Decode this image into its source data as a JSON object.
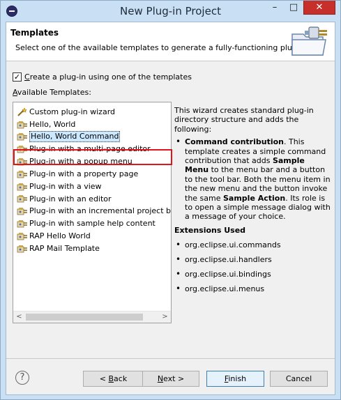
{
  "window": {
    "title": "New Plug-in Project",
    "controls": {
      "minimize": "–",
      "maximize": "□",
      "close": "✕"
    }
  },
  "header": {
    "title": "Templates",
    "description": "Select one of the available templates to generate a fully-functioning plug-in."
  },
  "checkbox": {
    "checked": true,
    "mnemonic": "C",
    "rest": "reate a plug-in using one of the templates"
  },
  "available_label": {
    "mnemonic": "A",
    "rest": "vailable Templates:"
  },
  "templates": [
    {
      "label": "Custom plug-in wizard",
      "icon": "wizard-icon"
    },
    {
      "label": "Hello, World",
      "icon": "plugin-template-icon"
    },
    {
      "label": "Hello, World Command",
      "icon": "plugin-template-icon",
      "selected": true
    },
    {
      "label": "Plug-in with a multi-page editor",
      "icon": "plugin-template-icon"
    },
    {
      "label": "Plug-in with a popup menu",
      "icon": "plugin-template-icon"
    },
    {
      "label": "Plug-in with a property page",
      "icon": "plugin-template-icon"
    },
    {
      "label": "Plug-in with a view",
      "icon": "plugin-template-icon"
    },
    {
      "label": "Plug-in with an editor",
      "icon": "plugin-template-icon"
    },
    {
      "label": "Plug-in with an incremental project build",
      "icon": "plugin-template-icon"
    },
    {
      "label": "Plug-in with sample help content",
      "icon": "plugin-template-icon"
    },
    {
      "label": "RAP Hello World",
      "icon": "plugin-template-icon"
    },
    {
      "label": "RAP Mail Template",
      "icon": "plugin-template-icon"
    }
  ],
  "description": {
    "intro": "This wizard creates standard plug-in directory structure and adds the following:",
    "bullet_bold": "Command contribution",
    "bullet_text_1": ". This template creates a simple command contribution that adds ",
    "bullet_bold_2": "Sample Menu",
    "bullet_text_2": " to the menu bar and a button to the tool bar. Both the menu item in the new menu and the button invoke the same ",
    "bullet_bold_3": "Sample Action",
    "bullet_text_3": ". Its role is to open a simple message dialog with a message of your choice.",
    "extensions_heading": "Extensions Used",
    "extensions": [
      "org.eclipse.ui.commands",
      "org.eclipse.ui.handlers",
      "org.eclipse.ui.bindings",
      "org.eclipse.ui.menus"
    ]
  },
  "buttons": {
    "help": "?",
    "back": {
      "prefix": "< ",
      "mnemonic": "B",
      "rest": "ack"
    },
    "next": {
      "mnemonic": "N",
      "rest": "ext >"
    },
    "finish": {
      "mnemonic": "F",
      "rest": "inish"
    },
    "cancel": "Cancel"
  },
  "scroll": {
    "left": "<",
    "right": ">"
  },
  "colors": {
    "selection_outline": "#e2141a",
    "selection_fill": "#cce8ff",
    "title_close": "#c7302a"
  }
}
